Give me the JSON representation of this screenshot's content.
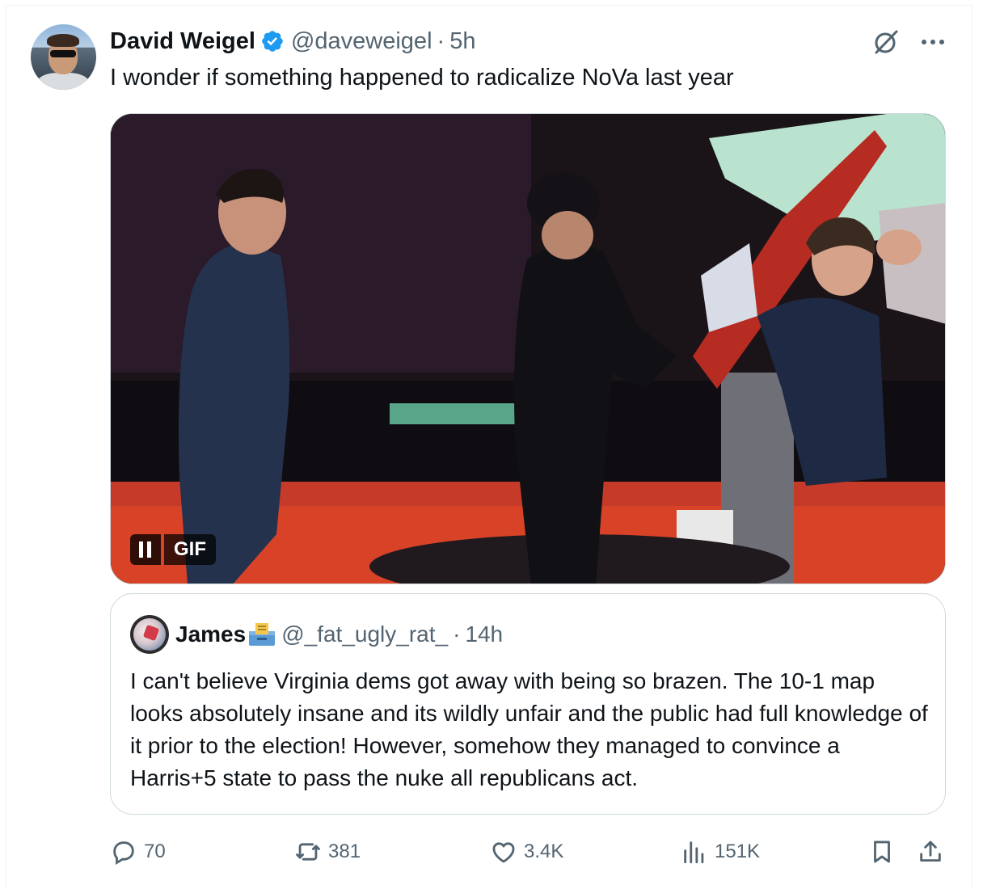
{
  "tweet": {
    "author_name": "David Weigel",
    "handle": "@daveweigel",
    "separator": "·",
    "time": "5h",
    "text": "I wonder if something happened to radicalize NoVa last year",
    "media": {
      "type_label": "GIF"
    }
  },
  "quoted_tweet": {
    "author_name": "James",
    "handle": "@_fat_ugly_rat_",
    "separator": "·",
    "time": "14h",
    "text": "I can't believe Virginia dems got away with being so brazen. The 10-1 map looks absolutely insane and its wildly unfair and the public had full knowledge of it prior to the election! However, somehow they managed to convince a Harris+5 state to pass the nuke all republicans act."
  },
  "actions": {
    "replies": "70",
    "reposts": "381",
    "likes": "3.4K",
    "views": "151K"
  },
  "colors": {
    "text_primary": "#0f1419",
    "text_secondary": "#536471",
    "verified_blue": "#1d9bf0",
    "border": "#cfd9de"
  },
  "icons": [
    "verified-badge-icon",
    "grok-icon",
    "more-icon",
    "pause-icon",
    "ballot-box-icon",
    "reply-icon",
    "repost-icon",
    "like-icon",
    "views-icon",
    "bookmark-icon",
    "share-icon"
  ]
}
